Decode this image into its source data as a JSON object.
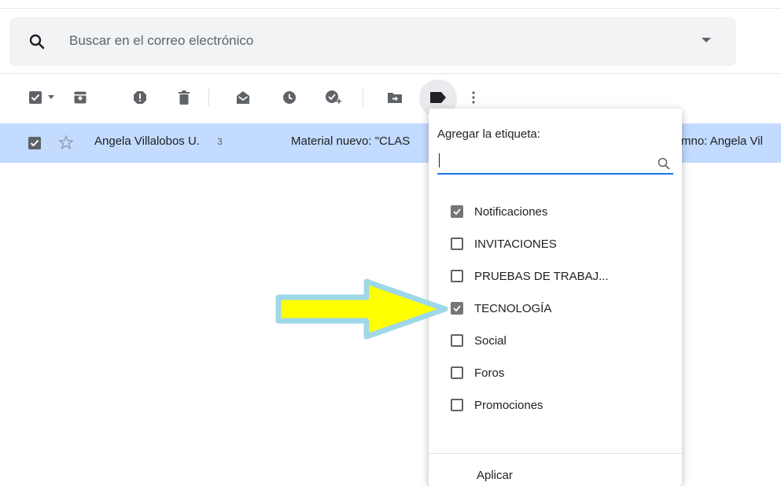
{
  "search": {
    "placeholder": "Buscar en el correo electrónico"
  },
  "toolbar": {
    "icons": [
      "select-all-checkbox-icon",
      "select-dropdown-icon",
      "archive-icon",
      "report-spam-icon",
      "delete-icon",
      "mark-read-icon",
      "snooze-icon",
      "add-to-tasks-icon",
      "move-to-icon",
      "label-icon",
      "more-icon"
    ]
  },
  "email": {
    "selected": true,
    "sender": "Angela Villalobos U.",
    "count": "3",
    "subject": "Material nuevo: \"CLAS",
    "preview_tail": "mno: Angela Vil"
  },
  "label_menu": {
    "title": "Agregar la etiqueta:",
    "search_value": "",
    "labels": [
      {
        "name": "Notificaciones",
        "checked": true
      },
      {
        "name": "INVITACIONES",
        "checked": false
      },
      {
        "name": "PRUEBAS DE TRABAJ...",
        "checked": false
      },
      {
        "name": "TECNOLOGÍA",
        "checked": true
      },
      {
        "name": "Social",
        "checked": false
      },
      {
        "name": "Foros",
        "checked": false
      },
      {
        "name": "Promociones",
        "checked": false
      }
    ],
    "apply_label": "Aplicar"
  },
  "colors": {
    "selected_row": "#c2dbff",
    "menu_field_underline": "#1a73e8",
    "arrow_fill": "#ffff00",
    "arrow_outline": "#9fd8e8"
  }
}
